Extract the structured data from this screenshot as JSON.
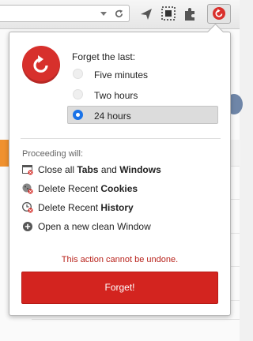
{
  "toolbar": {
    "icons": [
      "dropdown-arrow-icon",
      "reload-icon",
      "send-icon",
      "screenshot-icon",
      "puzzle-icon",
      "forget-extension-icon"
    ]
  },
  "background_page": {
    "right_column_text": "e"
  },
  "popup": {
    "heading": "Forget the last:",
    "options": [
      {
        "label": "Five minutes",
        "selected": false
      },
      {
        "label": "Two hours",
        "selected": false
      },
      {
        "label": "24 hours",
        "selected": true
      }
    ],
    "proceeding_label": "Proceeding will:",
    "actions": [
      {
        "pre": "Close all ",
        "bold1": "Tabs",
        "mid": " and ",
        "bold2": "Windows",
        "icon": "close-windows-icon"
      },
      {
        "pre": "Delete Recent ",
        "bold1": "Cookies",
        "mid": "",
        "bold2": "",
        "icon": "delete-cookies-icon"
      },
      {
        "pre": "Delete Recent ",
        "bold1": "History",
        "mid": "",
        "bold2": "",
        "icon": "delete-history-icon"
      },
      {
        "pre": "Open a new clean Window",
        "bold1": "",
        "mid": "",
        "bold2": "",
        "icon": "new-window-plus-icon"
      }
    ],
    "warning": "This action cannot be undone.",
    "forget_button": "Forget!",
    "colors": {
      "accent_red": "#d3241f",
      "warning_red": "#b8221b",
      "radio_blue": "#1a73e8"
    }
  }
}
